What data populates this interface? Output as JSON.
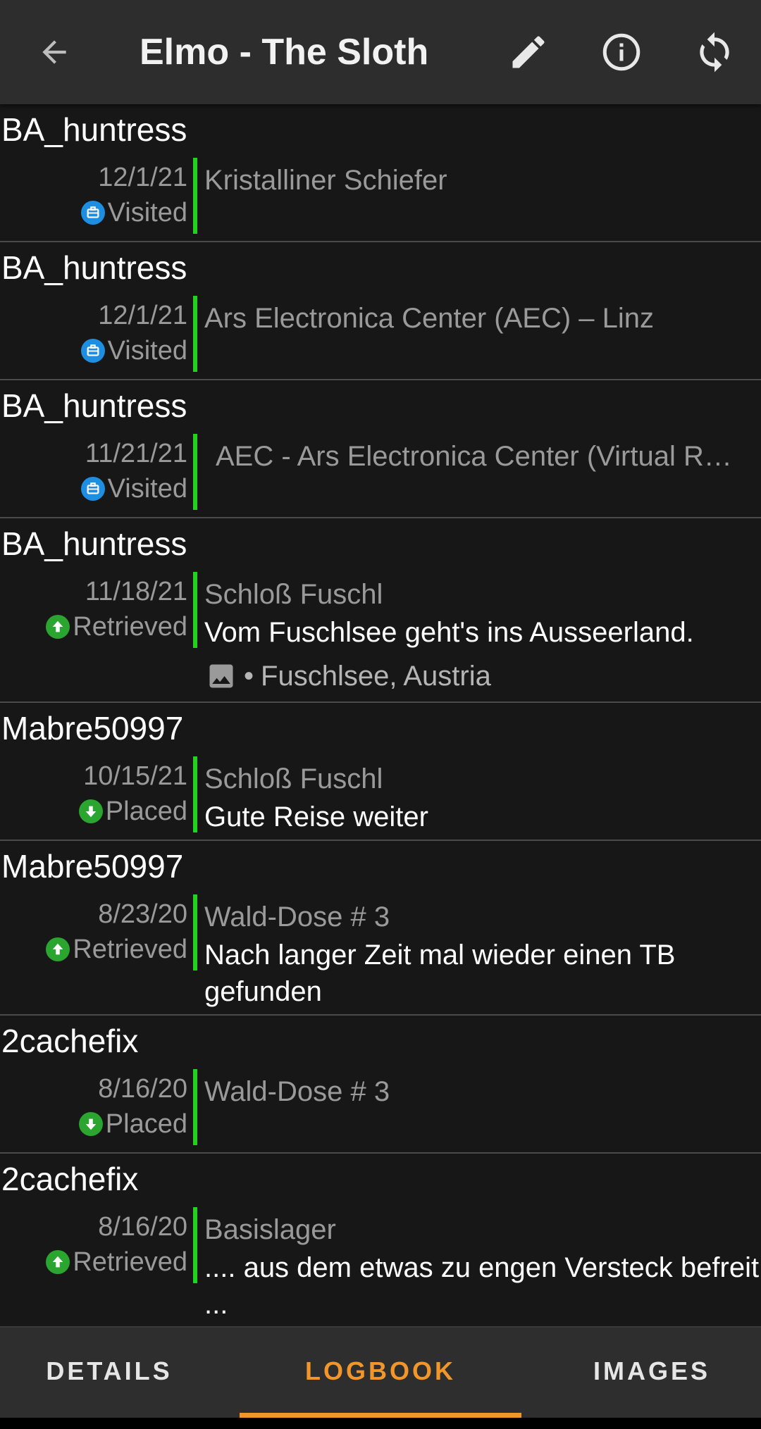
{
  "appbar": {
    "title": "Elmo - The Sloth",
    "back_icon": "arrow-back-icon",
    "edit_icon": "pencil-icon",
    "info_icon": "info-icon",
    "sync_icon": "sync-icon"
  },
  "colors": {
    "accent": "#f0962a",
    "bar": "#22d31e",
    "visited_badge": "#1e8fe0",
    "retrieved_badge": "#2aa52f"
  },
  "logs": [
    {
      "author": "BA_huntress",
      "date": "12/1/21",
      "type": "Visited",
      "cache": "Kristalliner Schiefer",
      "text": "",
      "location": ""
    },
    {
      "author": "BA_huntress",
      "date": "12/1/21",
      "type": "Visited",
      "cache": "Ars Electronica Center (AEC) – Linz",
      "text": "",
      "location": ""
    },
    {
      "author": "BA_huntress",
      "date": "11/21/21",
      "type": "Visited",
      "cache": "AEC - Ars Electronica Center (Virtual R…",
      "text": "",
      "location": ""
    },
    {
      "author": "BA_huntress",
      "date": "11/18/21",
      "type": "Retrieved",
      "cache": "Schloß Fuschl",
      "text": "Vom Fuschlsee geht's ins Ausseerland.",
      "location": "Fuschlsee, Austria"
    },
    {
      "author": "Mabre50997",
      "date": "10/15/21",
      "type": "Placed",
      "cache": "Schloß Fuschl",
      "text": "Gute Reise weiter",
      "location": ""
    },
    {
      "author": "Mabre50997",
      "date": "8/23/20",
      "type": "Retrieved",
      "cache": "Wald-Dose # 3",
      "text": "Nach langer Zeit mal wieder einen TB gefunden",
      "location": ""
    },
    {
      "author": "2cachefix",
      "date": "8/16/20",
      "type": "Placed",
      "cache": "Wald-Dose # 3",
      "text": "",
      "location": ""
    },
    {
      "author": "2cachefix",
      "date": "8/16/20",
      "type": "Retrieved",
      "cache": "Basislager",
      "text": ".... aus dem etwas zu engen Versteck befreit ...",
      "location": ""
    }
  ],
  "location_separator": "•",
  "tabs": [
    {
      "label": "DETAILS",
      "selected": false
    },
    {
      "label": "LOGBOOK",
      "selected": true
    },
    {
      "label": "IMAGES",
      "selected": false
    }
  ]
}
